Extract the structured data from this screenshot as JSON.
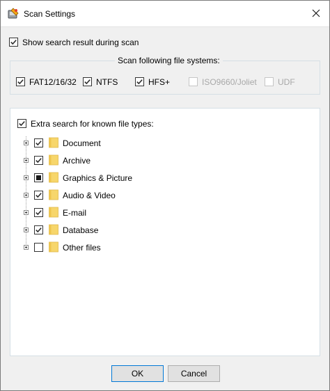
{
  "window": {
    "title": "Scan Settings"
  },
  "options": {
    "show_results_label": "Show search result during scan",
    "show_results_checked": true
  },
  "file_systems": {
    "legend": "Scan following file systems:",
    "items": [
      {
        "label": "FAT12/16/32",
        "checked": true,
        "enabled": true
      },
      {
        "label": "NTFS",
        "checked": true,
        "enabled": true
      },
      {
        "label": "HFS+",
        "checked": true,
        "enabled": true
      },
      {
        "label": "ISO9660/Joliet",
        "checked": false,
        "enabled": false
      },
      {
        "label": "UDF",
        "checked": false,
        "enabled": false
      }
    ]
  },
  "file_types": {
    "label": "Extra search for known file types:",
    "checked": true,
    "items": [
      {
        "label": "Document",
        "state": "checked"
      },
      {
        "label": "Archive",
        "state": "checked"
      },
      {
        "label": "Graphics & Picture",
        "state": "partial"
      },
      {
        "label": "Audio & Video",
        "state": "checked"
      },
      {
        "label": "E-mail",
        "state": "checked"
      },
      {
        "label": "Database",
        "state": "checked"
      },
      {
        "label": "Other files",
        "state": "unchecked"
      }
    ]
  },
  "buttons": {
    "ok": "OK",
    "cancel": "Cancel"
  },
  "colors": {
    "folder": "#f7d66b",
    "folder_tab": "#eec54e",
    "checkmark": "#2b2b2b",
    "default_button_border": "#0078d7"
  }
}
